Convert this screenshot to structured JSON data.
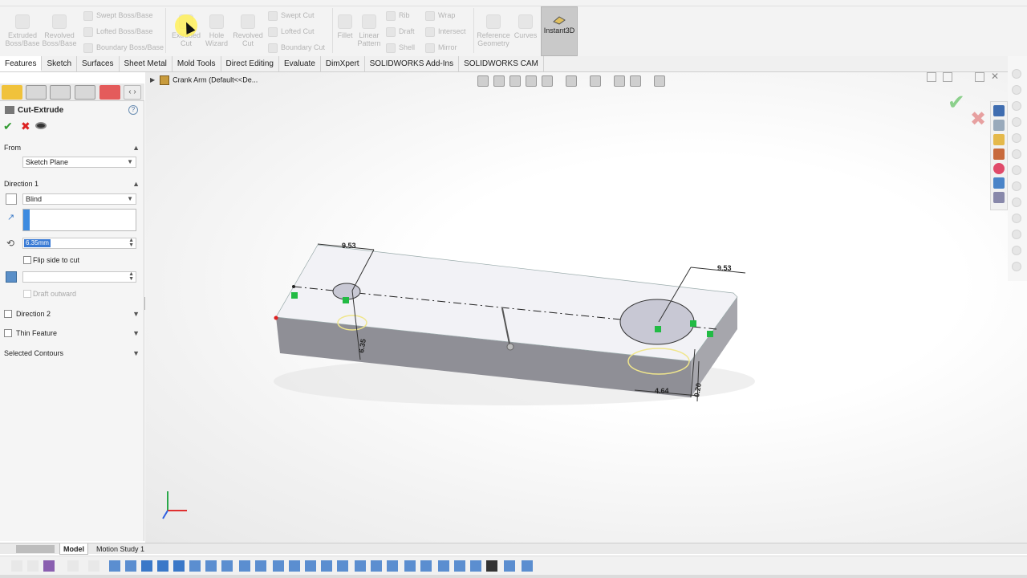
{
  "ribbon": {
    "extruded_boss": "Extruded Boss/Base",
    "revolved_boss": "Revolved Boss/Base",
    "swept_boss": "Swept Boss/Base",
    "lofted_boss": "Lofted Boss/Base",
    "boundary_boss": "Boundary Boss/Base",
    "extruded_cut": "Extruded Cut",
    "hole_wizard": "Hole Wizard",
    "revolved_cut": "Revolved Cut",
    "swept_cut": "Swept Cut",
    "lofted_cut": "Lofted Cut",
    "boundary_cut": "Boundary Cut",
    "fillet": "Fillet",
    "linear_pattern": "Linear Pattern",
    "rib": "Rib",
    "draft": "Draft",
    "shell": "Shell",
    "wrap": "Wrap",
    "intersect": "Intersect",
    "mirror": "Mirror",
    "reference_geometry": "Reference Geometry",
    "curves": "Curves",
    "instant3d": "Instant3D"
  },
  "tabs": [
    "Features",
    "Sketch",
    "Surfaces",
    "Sheet Metal",
    "Mold Tools",
    "Direct Editing",
    "Evaluate",
    "DimXpert",
    "SOLIDWORKS Add-Ins",
    "SOLIDWORKS CAM"
  ],
  "panel": {
    "title": "Cut-Extrude",
    "help": "?",
    "from_label": "From",
    "from_value": "Sketch Plane",
    "direction1_label": "Direction 1",
    "end_condition": "Blind",
    "depth_value": "6.35mm",
    "flip_side": "Flip side to cut",
    "draft_outward": "Draft outward",
    "direction2_label": "Direction 2",
    "thin_feature": "Thin Feature",
    "selected_contours": "Selected Contours"
  },
  "tree": {
    "part_name": "Crank Arm  (Default<<De..."
  },
  "model": {
    "dim_left_top": "9.53",
    "dim_right_top": "9.53",
    "dim_left_vert": "6.35",
    "dim_right_bottom": "4.64",
    "dim_right_vert": "0.20"
  },
  "bottom": {
    "model_tab": "Model",
    "motion_tab": "Motion Study 1"
  },
  "colors": {
    "accent_blue": "#3d8be0",
    "ok_green": "#2f9a2f",
    "cancel_red": "#dd2222",
    "sketch_green": "#22bb44",
    "model_face": "#f2f2f6",
    "model_side": "#8f8f96"
  }
}
